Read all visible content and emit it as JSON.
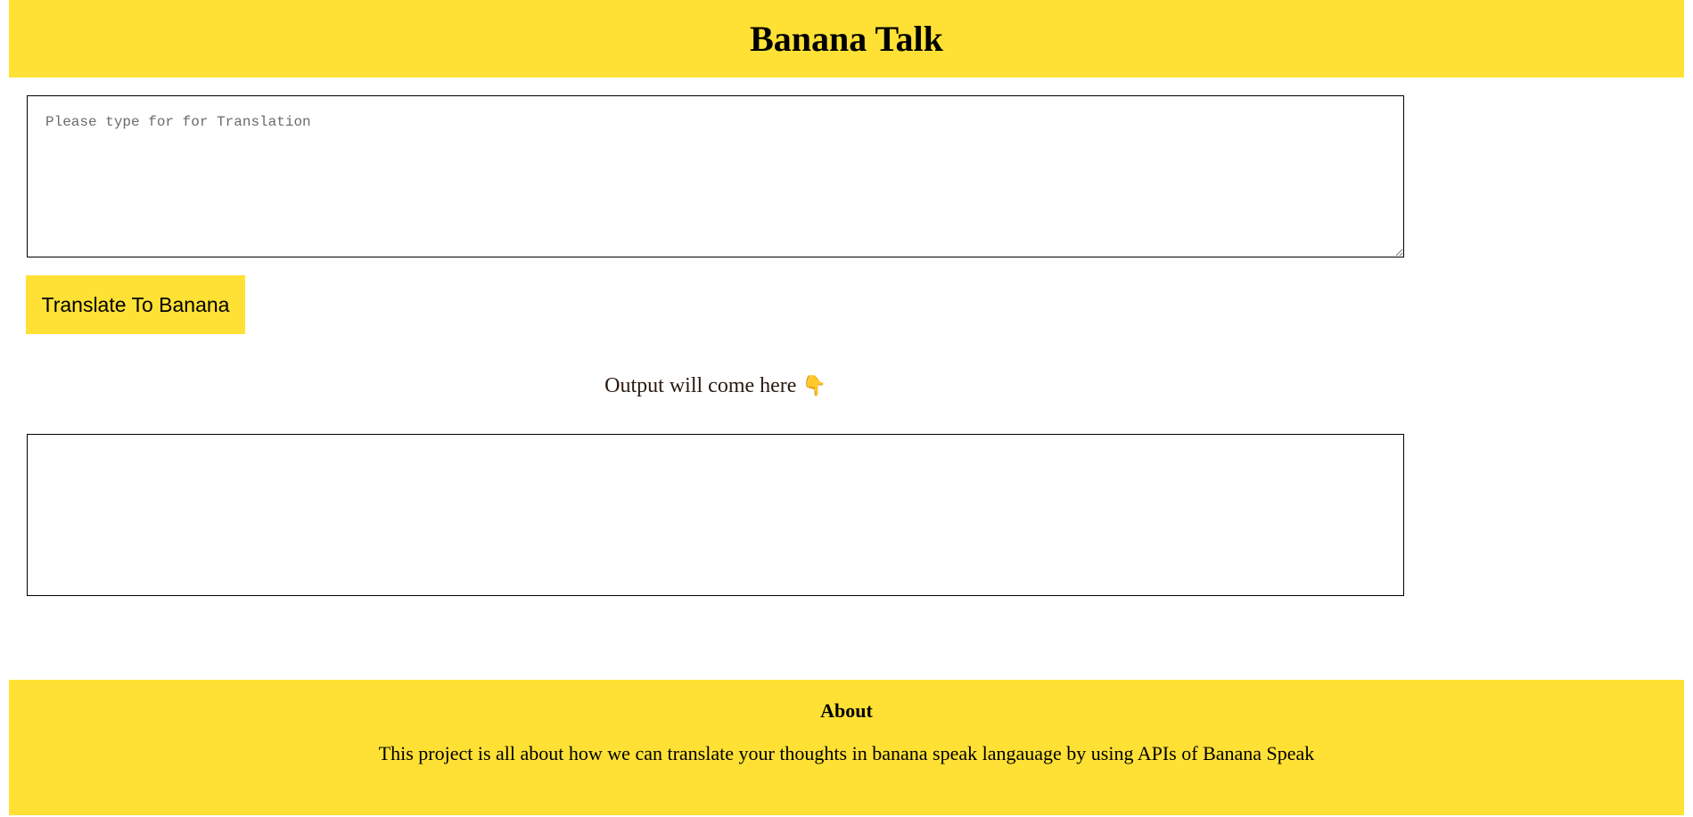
{
  "header": {
    "title": "Banana Talk"
  },
  "input": {
    "placeholder": "Please type for for Translation",
    "value": ""
  },
  "translate_button": {
    "label": "Translate To Banana"
  },
  "output": {
    "label": "Output will come here",
    "icon": "pointing-down-hand-icon",
    "icon_glyph": "👇",
    "value": ""
  },
  "footer": {
    "heading": "About",
    "description": "This project is all about how we can translate your thoughts in banana speak langauage by using APIs of Banana Speak"
  },
  "colors": {
    "accent": "#ffe135",
    "border": "#000000",
    "text": "#000000"
  }
}
